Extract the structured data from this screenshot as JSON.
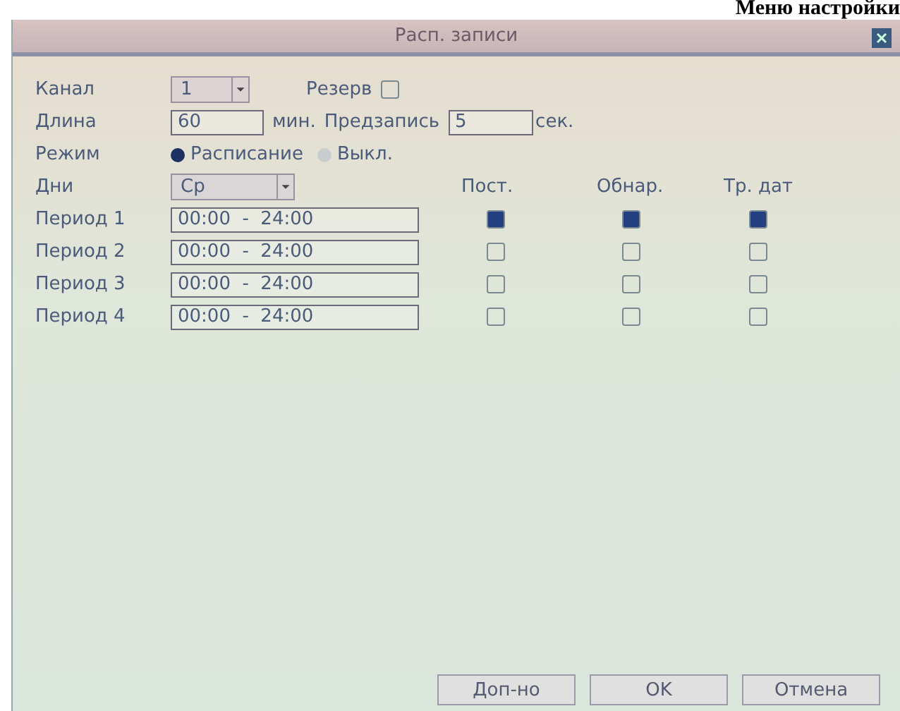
{
  "caption": "Меню настройки",
  "window": {
    "title": "Расп. записи"
  },
  "channel": {
    "label": "Канал",
    "value": "1",
    "reserve_label": "Резерв",
    "reserve_checked": false
  },
  "length": {
    "label": "Длина",
    "value": "60",
    "unit": "мин.",
    "prerecord_label": "Предзапись",
    "prerecord_value": "5",
    "prerecord_unit": "сек."
  },
  "mode": {
    "label": "Режим",
    "options": [
      {
        "label": "Расписание",
        "selected": true
      },
      {
        "label": "Выкл.",
        "selected": false
      }
    ]
  },
  "days": {
    "label": "Дни",
    "value": "Ср"
  },
  "columns": [
    "Пост.",
    "Обнар.",
    "Тр. дат"
  ],
  "periods": [
    {
      "label": "Период 1",
      "range": "00:00  -  24:00",
      "checks": [
        true,
        true,
        true
      ]
    },
    {
      "label": "Период 2",
      "range": "00:00  -  24:00",
      "checks": [
        false,
        false,
        false
      ]
    },
    {
      "label": "Период 3",
      "range": "00:00  -  24:00",
      "checks": [
        false,
        false,
        false
      ]
    },
    {
      "label": "Период 4",
      "range": "00:00  -  24:00",
      "checks": [
        false,
        false,
        false
      ]
    }
  ],
  "buttons": [
    "Доп-но",
    "OK",
    "Отмена"
  ]
}
